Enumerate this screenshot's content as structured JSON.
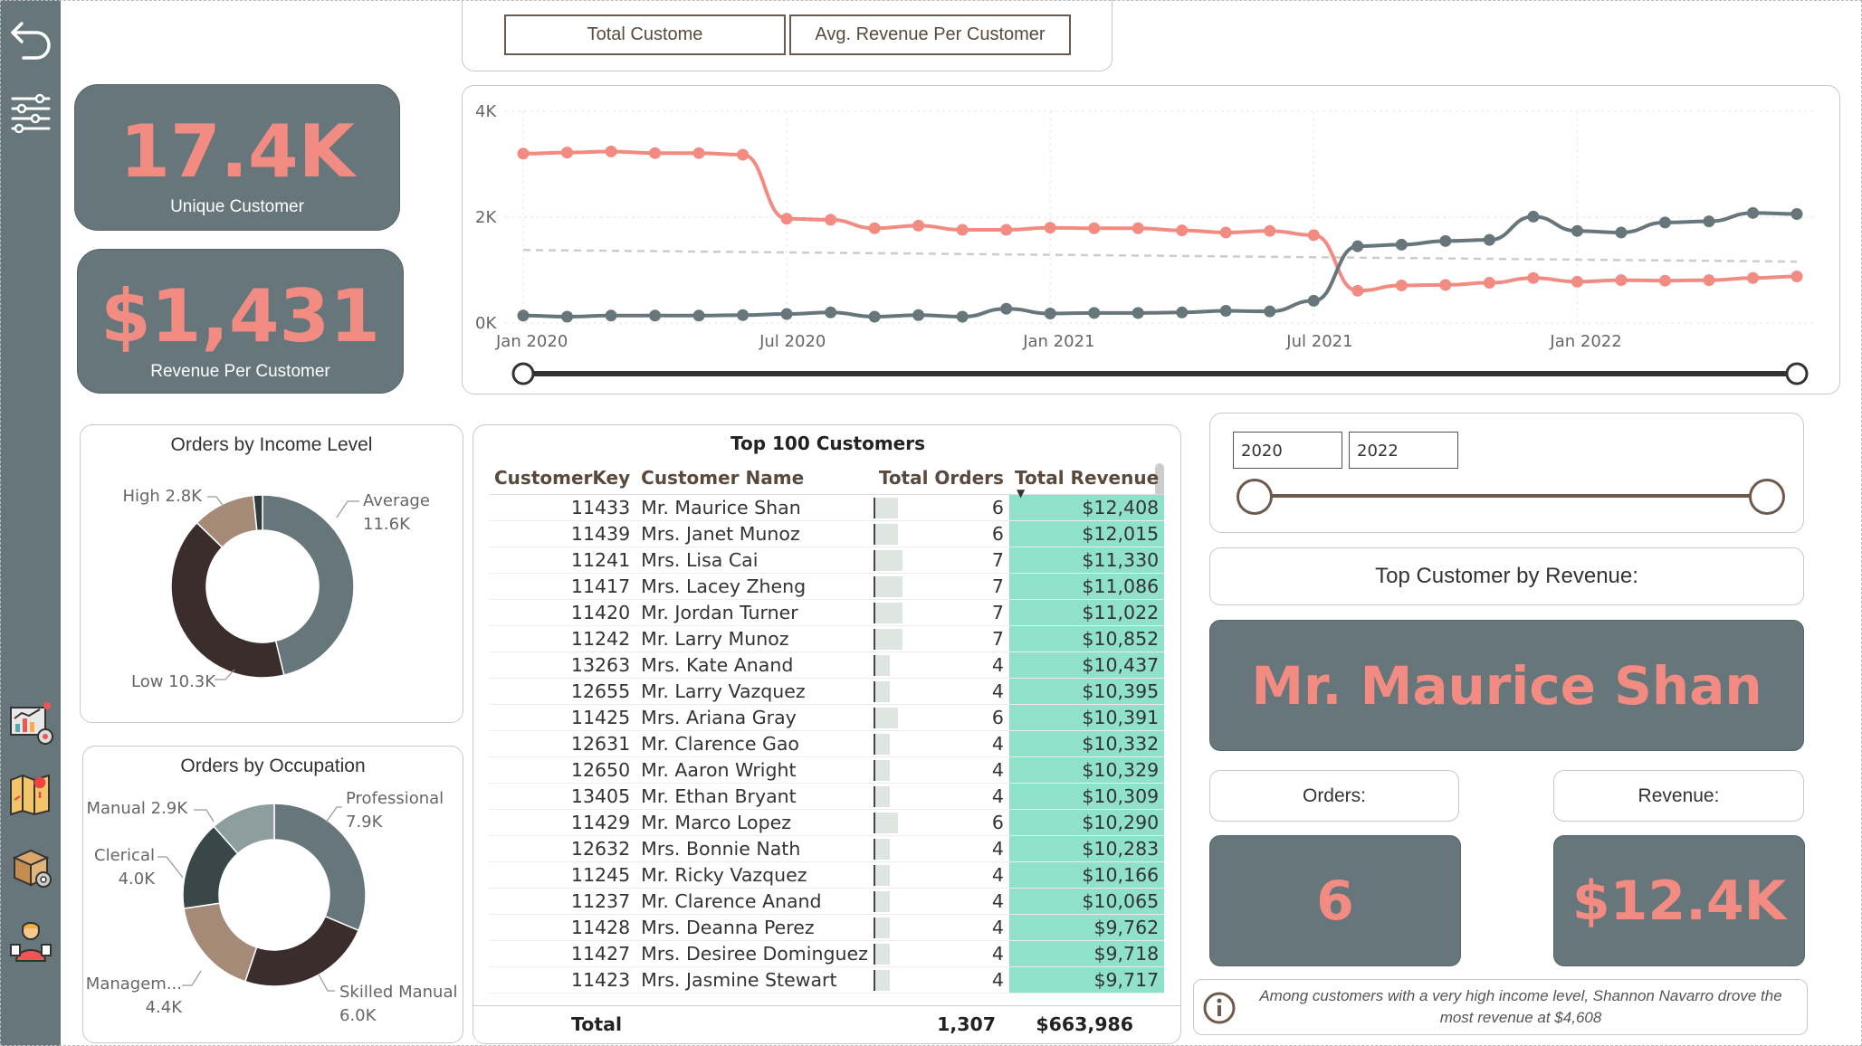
{
  "toggle": {
    "btn1": "Total Custome",
    "btn2": "Avg. Revenue Per Customer"
  },
  "kpis": {
    "unique_value": "17.4K",
    "unique_label": "Unique Customer",
    "rpc_value": "$1,431",
    "rpc_label": "Revenue Per Customer"
  },
  "chart_data": [
    {
      "type": "line",
      "x": [
        "2020-01",
        "2020-02",
        "2020-03",
        "2020-04",
        "2020-05",
        "2020-06",
        "2020-07",
        "2020-08",
        "2020-09",
        "2020-10",
        "2020-11",
        "2020-12",
        "2021-01",
        "2021-02",
        "2021-03",
        "2021-04",
        "2021-05",
        "2021-06",
        "2021-07",
        "2021-08",
        "2021-09",
        "2021-10",
        "2021-11",
        "2021-12",
        "2022-01",
        "2022-02",
        "2022-03",
        "2022-04",
        "2022-05",
        "2022-06"
      ],
      "x_ticks": [
        "Jan 2020",
        "Jul 2020",
        "Jan 2021",
        "Jul 2021",
        "Jan 2022"
      ],
      "y_ticks": [
        "0K",
        "2K",
        "4K"
      ],
      "ylim": [
        0,
        4000
      ],
      "series": [
        {
          "color": "#f28b82",
          "values": [
            3200,
            3220,
            3240,
            3210,
            3210,
            3180,
            1970,
            1950,
            1790,
            1840,
            1760,
            1760,
            1800,
            1790,
            1790,
            1750,
            1710,
            1740,
            1660,
            610,
            710,
            720,
            760,
            850,
            780,
            810,
            800,
            810,
            850,
            880
          ]
        },
        {
          "color": "#66767a",
          "values": [
            140,
            120,
            140,
            140,
            140,
            150,
            170,
            200,
            120,
            150,
            120,
            270,
            180,
            190,
            190,
            200,
            230,
            220,
            420,
            1450,
            1480,
            1550,
            1570,
            2010,
            1740,
            1710,
            1900,
            1920,
            2080,
            2060
          ]
        }
      ],
      "trendline": {
        "color": "#cccccc",
        "start": 1380,
        "end": 1160
      },
      "grid": true
    },
    {
      "type": "pie",
      "title": "Orders by Income Level",
      "labels": [
        "Average",
        "Low",
        "High",
        ""
      ],
      "display": [
        "Average\n11.6K",
        "Low 10.3K",
        "High 2.8K",
        ""
      ],
      "values": [
        11600,
        10300,
        2800,
        400
      ],
      "colors": [
        "#66767a",
        "#3b2d2b",
        "#a48a77",
        "#2f3b3d"
      ]
    },
    {
      "type": "pie",
      "title": "Orders by Occupation",
      "labels": [
        "Professional",
        "Skilled Manual",
        "Managem...",
        "Clerical",
        "Manual"
      ],
      "display": [
        "Professional\n7.9K",
        "Skilled Manual\n6.0K",
        "Managem...\n4.4K",
        "Clerical\n4.0K",
        "Manual 2.9K"
      ],
      "values": [
        7900,
        6000,
        4400,
        4000,
        2900
      ],
      "colors": [
        "#66767a",
        "#3b2d2b",
        "#a48a77",
        "#3a4749",
        "#8e9da0"
      ]
    }
  ],
  "table": {
    "title": "Top 100 Customers",
    "headers": [
      "CustomerKey",
      "Customer Name",
      "Total Orders",
      "Total Revenue"
    ],
    "rows": [
      [
        "11433",
        "Mr. Maurice Shan",
        6,
        "$12,408"
      ],
      [
        "11439",
        "Mrs. Janet Munoz",
        6,
        "$12,015"
      ],
      [
        "11241",
        "Mrs. Lisa Cai",
        7,
        "$11,330"
      ],
      [
        "11417",
        "Mrs. Lacey Zheng",
        7,
        "$11,086"
      ],
      [
        "11420",
        "Mr. Jordan Turner",
        7,
        "$11,022"
      ],
      [
        "11242",
        "Mr. Larry Munoz",
        7,
        "$10,852"
      ],
      [
        "13263",
        "Mrs. Kate Anand",
        4,
        "$10,437"
      ],
      [
        "12655",
        "Mr. Larry Vazquez",
        4,
        "$10,395"
      ],
      [
        "11425",
        "Mrs. Ariana Gray",
        6,
        "$10,391"
      ],
      [
        "12631",
        "Mr. Clarence Gao",
        4,
        "$10,332"
      ],
      [
        "12650",
        "Mr. Aaron Wright",
        4,
        "$10,329"
      ],
      [
        "13405",
        "Mr. Ethan Bryant",
        4,
        "$10,309"
      ],
      [
        "11429",
        "Mr. Marco Lopez",
        6,
        "$10,290"
      ],
      [
        "12632",
        "Mrs. Bonnie Nath",
        4,
        "$10,283"
      ],
      [
        "11245",
        "Mr. Ricky Vazquez",
        4,
        "$10,166"
      ],
      [
        "11237",
        "Mr. Clarence Anand",
        4,
        "$10,065"
      ],
      [
        "11428",
        "Mrs. Deanna Perez",
        4,
        "$9,762"
      ],
      [
        "11427",
        "Mrs. Desiree Dominguez",
        4,
        "$9,718"
      ],
      [
        "11423",
        "Mrs. Jasmine Stewart",
        4,
        "$9,717"
      ]
    ],
    "total_label": "Total",
    "total_orders": "1,307",
    "total_revenue": "$663,986"
  },
  "filter": {
    "start": "2020",
    "end": "2022"
  },
  "top": {
    "label": "Top Customer by Revenue:",
    "name": "Mr. Maurice Shan",
    "orders_label": "Orders:",
    "orders_value": "6",
    "revenue_label": "Revenue:",
    "revenue_value": "$12.4K"
  },
  "insight": "Among customers with a very high income level, Shannon Navarro drove the most revenue at $4,608"
}
